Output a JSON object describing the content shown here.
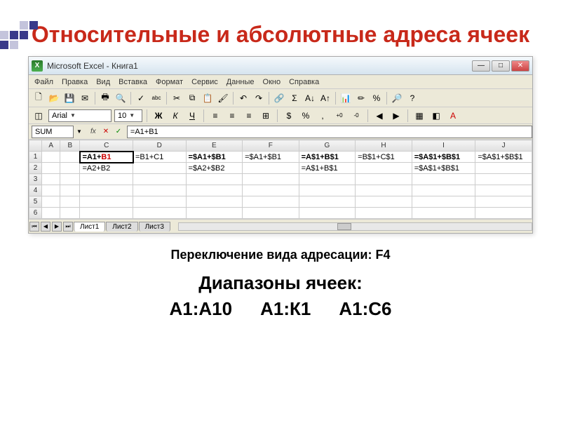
{
  "slide": {
    "title": "Относительные и абсолютные адреса ячеек",
    "caption": "Переключение вида адресации:  F4",
    "ranges_title": "Диапазоны ячеек:",
    "ranges": [
      "А1:А10",
      "А1:К1",
      "А1:С6"
    ]
  },
  "window": {
    "app_label": "X",
    "title": "Microsoft Excel - Книга1",
    "min": "—",
    "max": "□",
    "close": "✕"
  },
  "menu": [
    "Файл",
    "Правка",
    "Вид",
    "Вставка",
    "Формат",
    "Сервис",
    "Данные",
    "Окно",
    "Справка"
  ],
  "format": {
    "font": "Arial",
    "size": "10",
    "bold": "Ж",
    "italic": "К",
    "underline": "Ч"
  },
  "formula": {
    "name": "SUM",
    "fx": "fx",
    "cancel": "✕",
    "accept": "✓",
    "value": "=A1+B1"
  },
  "cols": [
    "A",
    "B",
    "C",
    "D",
    "E",
    "F",
    "G",
    "H",
    "I",
    "J"
  ],
  "rows": [
    "1",
    "2",
    "3",
    "4",
    "5",
    "6"
  ],
  "cells": {
    "r1": {
      "C_pre": "=A1+",
      "C_red": "B1",
      "D": "=B1+C1",
      "E": "=$A1+$B1",
      "F": "=$A1+$B1",
      "G": "=A$1+B$1",
      "H": "=B$1+C$1",
      "I": "=$A$1+$B$1",
      "J": "=$A$1+$B$1"
    },
    "r2": {
      "C": "=A2+B2",
      "E": "=$A2+$B2",
      "G": "=A$1+B$1",
      "I": "=$A$1+$B$1"
    }
  },
  "tabs": {
    "t1": "Лист1",
    "t2": "Лист2",
    "t3": "Лист3"
  },
  "icons": {
    "new": "🗋",
    "open": "📂",
    "save": "💾",
    "mail": "✉",
    "print": "🖶",
    "preview": "🔍",
    "spell": "✓",
    "abc": "abc",
    "cut": "✂",
    "copy": "⧉",
    "paste": "📋",
    "brush": "🖌",
    "undo": "↶",
    "redo": "↷",
    "link": "🔗",
    "sum": "Σ",
    "sort_a": "A↓",
    "sort_d": "A↑",
    "chart": "📊",
    "draw": "✏",
    "pct": "%",
    "zoom": "🔎",
    "help": "?",
    "al": "≡",
    "ac": "≡",
    "ar": "≡",
    "merge": "⊞",
    "cur": "$",
    "pct2": "%",
    "comma": ",",
    "dec_i": "+0",
    "dec_d": "-0",
    "indent_l": "◀",
    "indent_r": "▶",
    "border": "▦",
    "fill": "◧",
    "font_c": "A"
  }
}
